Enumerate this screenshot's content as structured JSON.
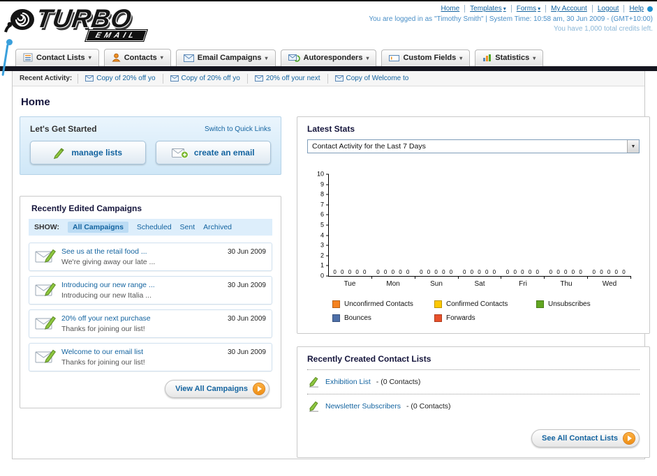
{
  "page_title": "Home",
  "header": {
    "logo_title": "TURBO",
    "logo_subtitle": "EMAIL",
    "nav_links": [
      "Home",
      "Templates",
      "Forms",
      "My Account",
      "Logout",
      "Help"
    ],
    "login_info": "You are logged in as \"Timothy Smith\" | System Time: 10:58 am, 30 Jun 2009 - (GMT+10:00)",
    "credits_info": "You have 1,000 total credits left."
  },
  "nav": {
    "tabs": [
      {
        "label": "Contact Lists"
      },
      {
        "label": "Contacts"
      },
      {
        "label": "Email Campaigns"
      },
      {
        "label": "Autoresponders"
      },
      {
        "label": "Custom Fields"
      },
      {
        "label": "Statistics"
      }
    ]
  },
  "recent_activity": {
    "label": "Recent Activity:",
    "items": [
      {
        "text": "Copy of 20% off yo"
      },
      {
        "text": "Copy of 20% off yo"
      },
      {
        "text": "20% off your next"
      },
      {
        "text": "Copy of Welcome to"
      }
    ]
  },
  "get_started": {
    "title": "Let's Get Started",
    "switch_link": "Switch to Quick Links",
    "manage_lists_label": "manage lists",
    "create_email_label": "create an email"
  },
  "campaigns": {
    "title": "Recently Edited Campaigns",
    "show_label": "SHOW:",
    "filters": [
      "All Campaigns",
      "Scheduled",
      "Sent",
      "Archived"
    ],
    "items": [
      {
        "title": "See us at the retail food ...",
        "subtitle": "We're giving away our late ...",
        "date": "30 Jun 2009"
      },
      {
        "title": "Introducing our new range ...",
        "subtitle": "Introducing our new Italia ...",
        "date": "30 Jun 2009"
      },
      {
        "title": "20% off your next purchase",
        "subtitle": "Thanks for joining our list!",
        "date": "30 Jun 2009"
      },
      {
        "title": "Welcome to our email list",
        "subtitle": "Thanks for joining our list!",
        "date": "30 Jun 2009"
      }
    ],
    "view_all_label": "View All Campaigns"
  },
  "stats": {
    "title": "Latest Stats",
    "dropdown_value": "Contact Activity for the Last 7 Days"
  },
  "contact_lists": {
    "title": "Recently Created Contact Lists",
    "items": [
      {
        "name": "Exhibition List",
        "detail": "- (0 Contacts)"
      },
      {
        "name": "Newsletter Subscribers",
        "detail": "- (0 Contacts)"
      }
    ],
    "see_all_label": "See All Contact Lists"
  },
  "chart_data": {
    "type": "bar",
    "title": "Contact Activity for the Last 7 Days",
    "categories": [
      "Tue",
      "Mon",
      "Sun",
      "Sat",
      "Fri",
      "Thu",
      "Wed"
    ],
    "series": [
      {
        "name": "Unconfirmed Contacts",
        "color": "#f5821f",
        "values": [
          0,
          0,
          0,
          0,
          0,
          0,
          0
        ]
      },
      {
        "name": "Confirmed Contacts",
        "color": "#fdc800",
        "values": [
          0,
          0,
          0,
          0,
          0,
          0,
          0
        ]
      },
      {
        "name": "Unsubscribes",
        "color": "#61a621",
        "values": [
          0,
          0,
          0,
          0,
          0,
          0,
          0
        ]
      },
      {
        "name": "Bounces",
        "color": "#4d6fa8",
        "values": [
          0,
          0,
          0,
          0,
          0,
          0,
          0
        ]
      },
      {
        "name": "Forwards",
        "color": "#e8502a",
        "values": [
          0,
          0,
          0,
          0,
          0,
          0,
          0
        ]
      }
    ],
    "ylim": [
      0,
      10
    ],
    "yticks": [
      0,
      1,
      2,
      3,
      4,
      5,
      6,
      7,
      8,
      9,
      10
    ],
    "xlabel": "",
    "ylabel": "",
    "grid": false,
    "legend_position": "bottom",
    "value_labels_shown": true
  },
  "colors": {
    "link_blue": "#1464a0",
    "accent_orange": "#ef8e14",
    "dark_bar": "#15151f"
  }
}
